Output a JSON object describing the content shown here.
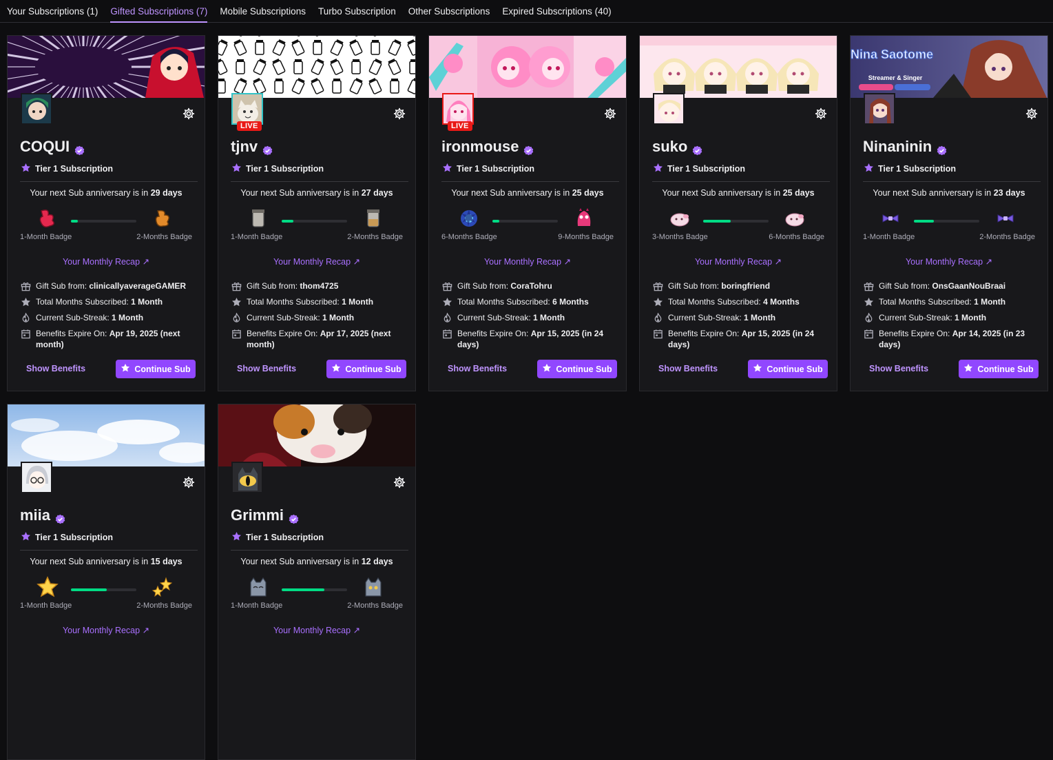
{
  "tabs": [
    {
      "label": "Your Subscriptions (1)",
      "active": false
    },
    {
      "label": "Gifted Subscriptions (7)",
      "active": true
    },
    {
      "label": "Mobile Subscriptions",
      "active": false
    },
    {
      "label": "Turbo Subscription",
      "active": false
    },
    {
      "label": "Other Subscriptions",
      "active": false
    },
    {
      "label": "Expired Subscriptions (40)",
      "active": false
    }
  ],
  "common": {
    "tier": "Tier 1 Subscription",
    "anniv_prefix": "Your next Sub anniversary is in ",
    "recap": "Your Monthly Recap ↗",
    "gift_label": "Gift Sub from: ",
    "total_label": "Total Months Subscribed: ",
    "streak_label": "Current Sub-Streak: ",
    "expire_label": "Benefits Expire On: ",
    "show_benefits": "Show Benefits",
    "continue": "Continue Sub",
    "live": "LIVE"
  },
  "accent": "#9147ff",
  "progress_color": "#00db84",
  "cards": [
    {
      "name": "COQUI",
      "days": "29 days",
      "badge_left": "1-Month Badge",
      "badge_right": "2-Months Badge",
      "progress": 0.1,
      "gifter": "clinicallyaverageGAMER",
      "total": "1 Month",
      "streak": "1 Month",
      "expire": "Apr 19, 2025 (next month)",
      "live": false,
      "banner": "coqui",
      "badge": "red"
    },
    {
      "name": "tjnv",
      "days": "27 days",
      "badge_left": "1-Month Badge",
      "badge_right": "2-Months Badge",
      "progress": 0.18,
      "gifter": "thom4725",
      "total": "1 Month",
      "streak": "1 Month",
      "expire": "Apr 17, 2025 (next month)",
      "live": true,
      "banner": "tjnv",
      "badge": "glass"
    },
    {
      "name": "ironmouse",
      "days": "25 days",
      "badge_left": "6-Months Badge",
      "badge_right": "9-Months Badge",
      "progress": 0.1,
      "gifter": "CoraTohru",
      "total": "6 Months",
      "streak": "1 Month",
      "expire": "Apr 15, 2025 (in 24 days)",
      "live": true,
      "banner": "ironmouse",
      "badge": "iron"
    },
    {
      "name": "suko",
      "days": "25 days",
      "badge_left": "3-Months Badge",
      "badge_right": "6-Months Badge",
      "progress": 0.42,
      "gifter": "boringfriend",
      "total": "4 Months",
      "streak": "1 Month",
      "expire": "Apr 15, 2025 (in 24 days)",
      "live": false,
      "banner": "suko",
      "badge": "pink"
    },
    {
      "name": "Ninaninin",
      "days": "23 days",
      "badge_left": "1-Month Badge",
      "badge_right": "2-Months Badge",
      "progress": 0.3,
      "gifter": "OnsGaanNouBraai",
      "total": "1 Month",
      "streak": "1 Month",
      "expire": "Apr 14, 2025 (in 23 days)",
      "live": false,
      "banner": "nina",
      "banner_title": "Nina Saotome",
      "banner_sub": "Streamer & Singer",
      "badge": "bow"
    },
    {
      "name": "miia",
      "days": "15 days",
      "badge_left": "1-Month Badge",
      "badge_right": "2-Months Badge",
      "progress": 0.55,
      "gifter": "",
      "total": "",
      "streak": "",
      "expire": "",
      "live": false,
      "banner": "miia",
      "badge": "star"
    },
    {
      "name": "Grimmi",
      "days": "12 days",
      "badge_left": "1-Month Badge",
      "badge_right": "2-Months Badge",
      "progress": 0.65,
      "gifter": "",
      "total": "",
      "streak": "",
      "expire": "",
      "live": false,
      "banner": "grimmi",
      "badge": "cat"
    }
  ]
}
